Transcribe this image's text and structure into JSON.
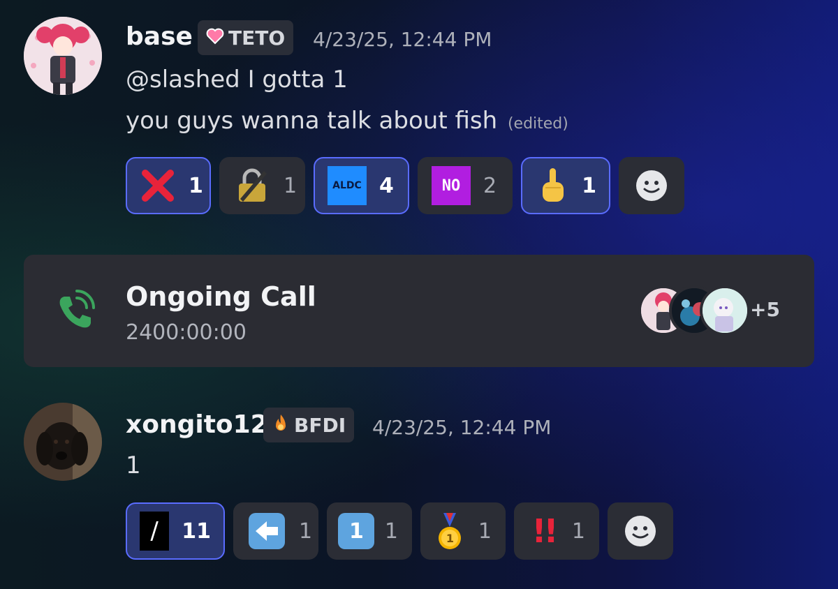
{
  "messages": [
    {
      "username": "base",
      "tag": {
        "icon": "pink-heart-icon",
        "text": "TETO"
      },
      "timestamp": "4/23/25, 12:44 PM",
      "lines": [
        "@slashed I gotta 1",
        "you guys wanna talk about fish"
      ],
      "edited_label": "(edited)",
      "reactions": [
        {
          "emoji": "red-x-icon",
          "count": "1",
          "active": true
        },
        {
          "emoji": "locked-pen-icon",
          "count": "1",
          "active": false
        },
        {
          "emoji": "aldc-custom-emoji",
          "text": "ALDC",
          "count": "4",
          "active": true
        },
        {
          "emoji": "no-custom-emoji",
          "text": "NO",
          "count": "2",
          "active": false
        },
        {
          "emoji": "hand-gesture-icon",
          "count": "1",
          "active": true
        }
      ]
    },
    {
      "username": "xongito12",
      "tag": {
        "icon": "fire-icon",
        "text": "BFDI"
      },
      "timestamp": "4/23/25, 12:44 PM",
      "lines": [
        "1"
      ],
      "reactions": [
        {
          "emoji": "slash-custom-emoji",
          "text": "/",
          "count": "11",
          "active": true
        },
        {
          "emoji": "left-arrow-icon",
          "count": "1",
          "active": false
        },
        {
          "emoji": "keycap-one-icon",
          "text": "1",
          "count": "1",
          "active": false
        },
        {
          "emoji": "first-place-medal-icon",
          "text": "1",
          "count": "1",
          "active": false
        },
        {
          "emoji": "double-exclamation-icon",
          "text": "!!",
          "count": "1",
          "active": false
        }
      ]
    }
  ],
  "call": {
    "title": "Ongoing Call",
    "duration": "2400:00:00",
    "extra_participants": "+5",
    "colors": {
      "icon": "#3ba55d",
      "card": "#2b2c33"
    }
  },
  "colors": {
    "active_reaction_border": "#5a6cff",
    "active_reaction_bg": "#2a3770",
    "reaction_bg": "#2b2d35"
  }
}
